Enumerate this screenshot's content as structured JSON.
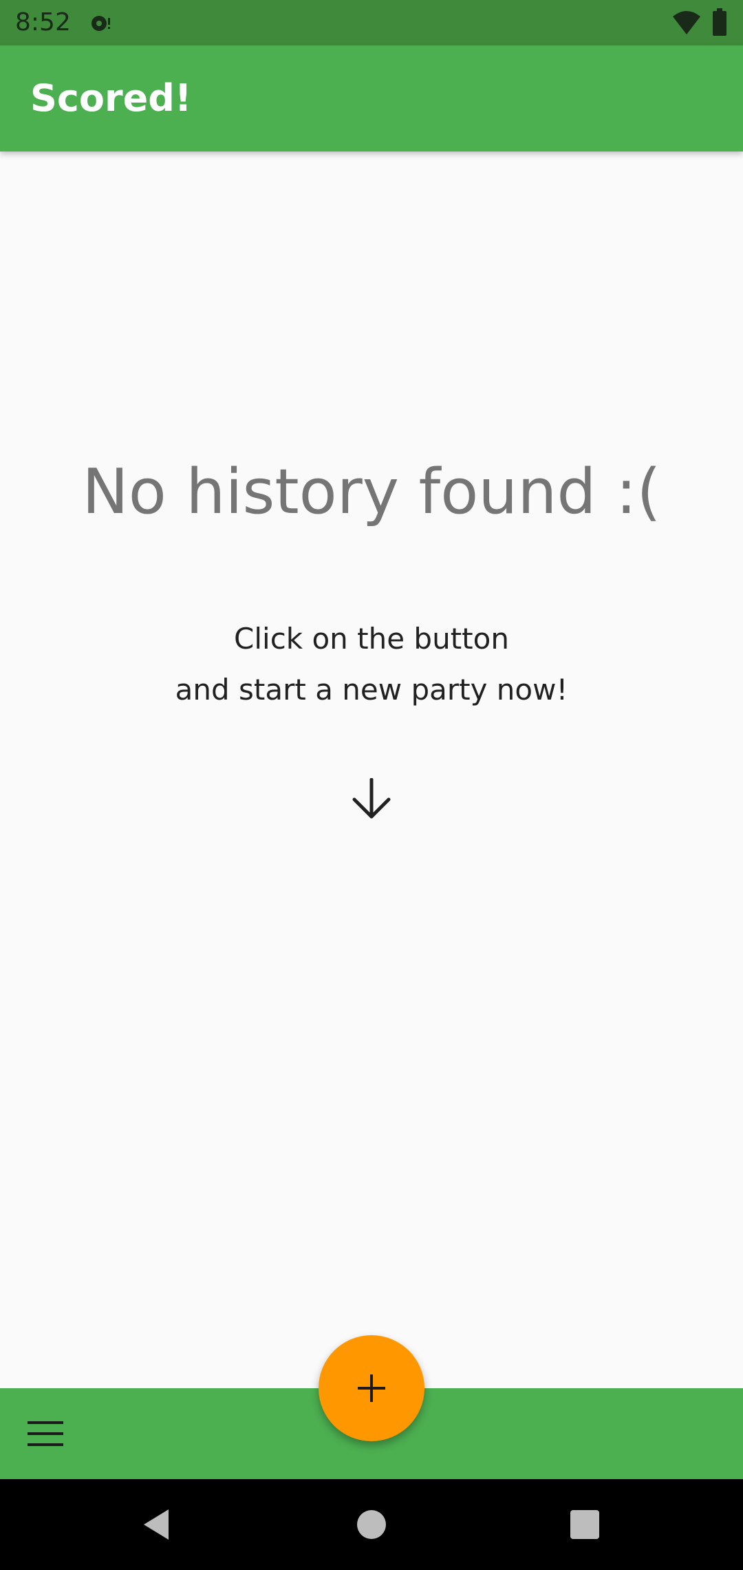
{
  "status_bar": {
    "time": "8:52",
    "icons": [
      "notification-icon",
      "wifi-icon",
      "battery-icon"
    ]
  },
  "app_bar": {
    "title": "Scored!"
  },
  "empty_state": {
    "title": "No history found :(",
    "line1": "Click on the button",
    "line2": "and start a new party now!",
    "icon": "arrow-down-icon"
  },
  "bottom_bar": {
    "menu_icon": "menu-icon"
  },
  "fab": {
    "icon": "plus-icon"
  },
  "nav_bar": {
    "icons": [
      "back-icon",
      "home-icon",
      "recents-icon"
    ]
  },
  "colors": {
    "primary": "#4caf50",
    "primary_dark": "#3f8a3b",
    "accent": "#ff9800",
    "background": "#fafafa",
    "title_gray": "#757575"
  }
}
